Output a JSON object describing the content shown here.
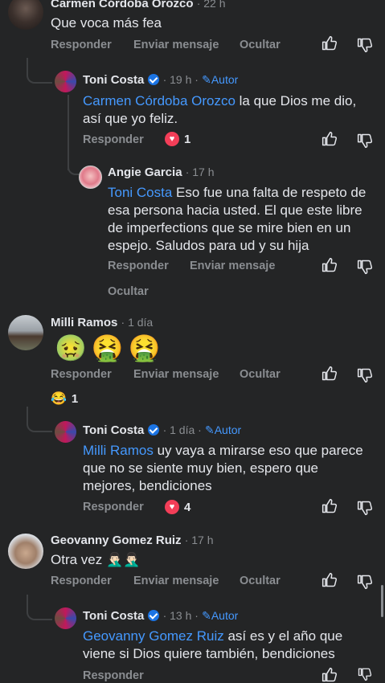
{
  "actions": {
    "reply": "Responder",
    "message": "Enviar mensaje",
    "hide": "Ocultar"
  },
  "comments": [
    {
      "name": "Carmen Córdoba Orozco",
      "time": "· 22 h",
      "text": "Que voca más fea"
    },
    {
      "name": "Toni Costa",
      "time": "· 19 h ·",
      "badge": "Autor",
      "mention": "Carmen Córdoba Orozco",
      "text": " la que Dios me dio, así que yo feliz.",
      "reaction_count": "1"
    },
    {
      "name": "Angie Garcia",
      "time": "· 17 h",
      "mention": "Toni Costa",
      "text": " Eso fue una falta de respeto de esa persona hacia usted. El que este libre de imperfections que se mire bien en un espejo. Saludos para ud y su hija"
    },
    {
      "name": "Milli Ramos",
      "time": "· 1 día",
      "emoji": [
        "🤢",
        "🤮",
        "🤮"
      ],
      "reaction_emoji": "😂",
      "reaction_count": "1"
    },
    {
      "name": "Toni Costa",
      "time": "· 1 día ·",
      "badge": "Autor",
      "mention": "Milli Ramos",
      "text": " uy vaya a mirarse eso que parece que no se siente muy bien, espero que mejores, bendiciones",
      "reaction_count": "4"
    },
    {
      "name": "Geovanny Gomez Ruiz",
      "time": "· 17 h",
      "text": "Otra vez 🤦🏻‍♂️🤦🏻‍♂️"
    },
    {
      "name": "Toni Costa",
      "time": "· 13 h ·",
      "badge": "Autor",
      "mention": "Geovanny Gomez Ruiz",
      "text": " así es y el año que viene si Dios quiere también, bendiciones"
    }
  ]
}
